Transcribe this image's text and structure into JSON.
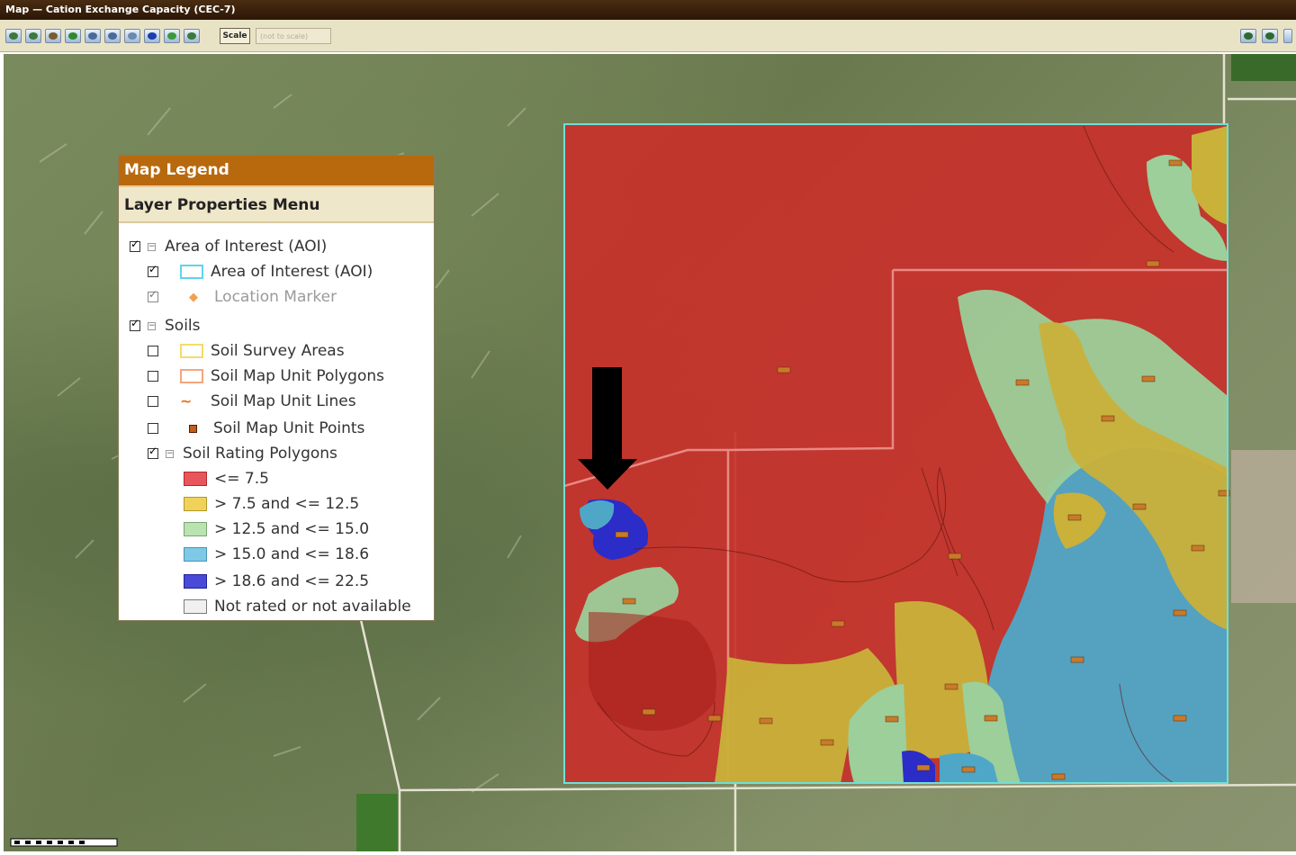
{
  "window": {
    "title": "Map — Cation Exchange Capacity (CEC-7)"
  },
  "toolbar": {
    "scale_label": "Scale",
    "scale_select_value": "(not to scale)",
    "icons": [
      "zoom-in-icon",
      "zoom-out-icon",
      "pan-icon",
      "full-extent-icon",
      "previous-extent-icon",
      "next-extent-icon",
      "identify-icon",
      "info-icon",
      "measure-icon",
      "print-icon"
    ],
    "right_icons": [
      "map-layout-icon",
      "legend-toggle-icon",
      "window-icon"
    ]
  },
  "legend": {
    "header": "Map Legend",
    "subheader": "Layer Properties Menu",
    "groups": [
      {
        "label": "Area of Interest (AOI)",
        "checked": true,
        "items": [
          {
            "label": "Area of Interest (AOI)",
            "checked": true,
            "symbol": "aoi-outline",
            "color": "#5fd3f0"
          },
          {
            "label": "Location Marker",
            "checked": true,
            "disabled": true,
            "symbol": "diamond",
            "color": "#f0a050"
          }
        ]
      },
      {
        "label": "Soils",
        "checked": true,
        "items": [
          {
            "label": "Soil Survey Areas",
            "checked": false,
            "symbol": "box",
            "color": "#f3dc6a"
          },
          {
            "label": "Soil Map Unit Polygons",
            "checked": false,
            "symbol": "box",
            "color": "#f5a57a"
          },
          {
            "label": "Soil Map Unit Lines",
            "checked": false,
            "symbol": "line",
            "color": "#e8741e"
          },
          {
            "label": "Soil Map Unit Points",
            "checked": false,
            "symbol": "point",
            "color": "#c0601a"
          },
          {
            "label": "Soil Rating Polygons",
            "checked": true,
            "symbol": "none"
          }
        ],
        "ratings": [
          {
            "label": "<= 7.5",
            "color": "#e8555b"
          },
          {
            "label": "> 7.5 and <= 12.5",
            "color": "#f0d25a"
          },
          {
            "label": "> 12.5 and <= 15.0",
            "color": "#b9e3b0"
          },
          {
            "label": "> 15.0 and <= 18.6",
            "color": "#7ecae6"
          },
          {
            "label": "> 18.6 and <= 22.5",
            "color": "#4a4ad8"
          },
          {
            "label": "Not rated or not available",
            "color": "#f0f0f0"
          }
        ]
      }
    ]
  },
  "colors": {
    "rating_red": "#c8302a",
    "rating_yellow": "#c9b13a",
    "rating_green": "#9ccf9a",
    "rating_cyan": "#4fa7c8",
    "rating_blue": "#2c2cc8",
    "aoi_outline": "#6ee0d8"
  }
}
